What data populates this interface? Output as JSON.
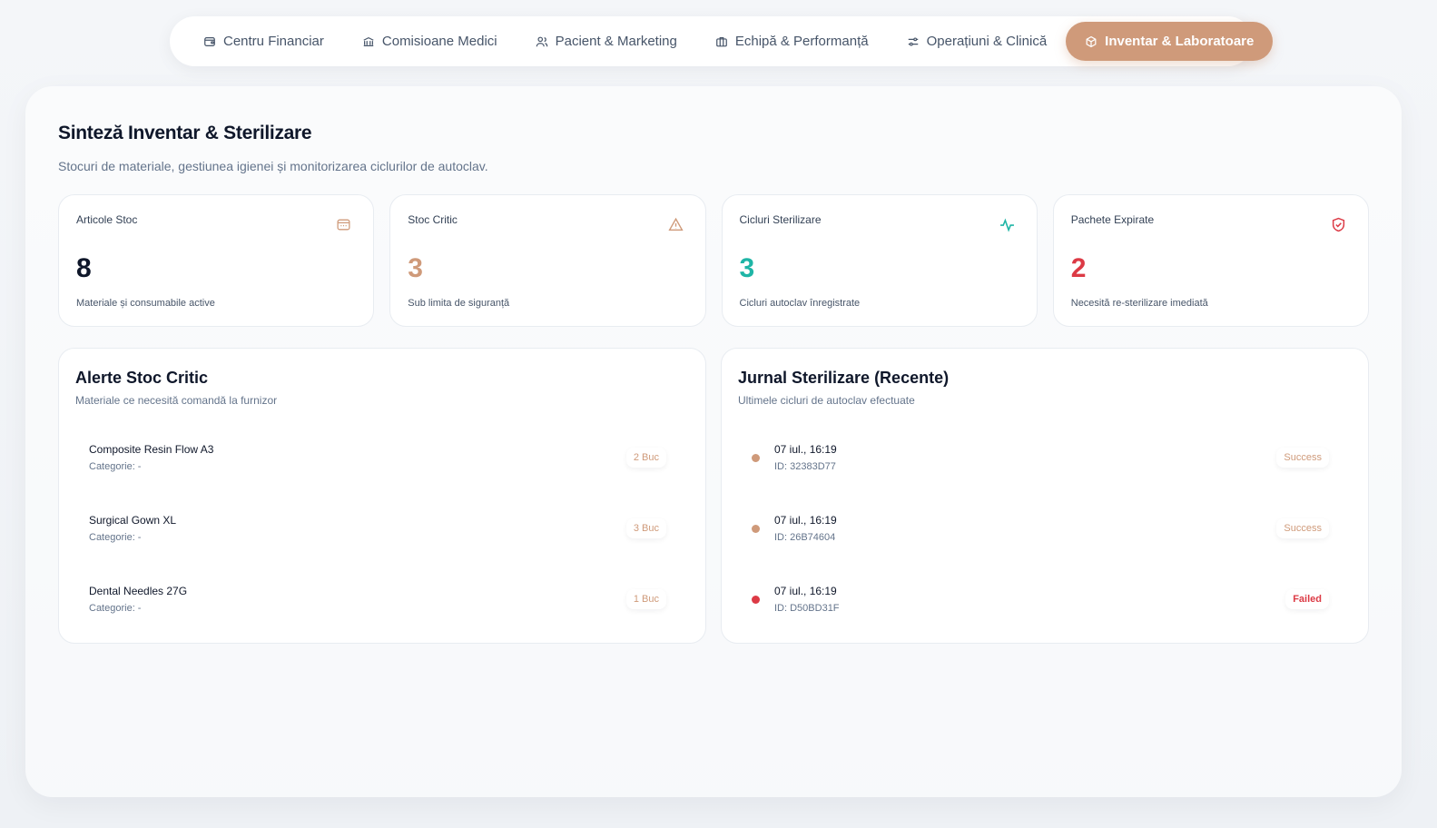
{
  "colors": {
    "accent": "#cf9a7a",
    "teal": "#1fb5a6",
    "danger": "#dc3a45",
    "dark": "#0f172a"
  },
  "nav": {
    "items": [
      {
        "label": "Centru Financiar",
        "icon": "wallet-icon"
      },
      {
        "label": "Comisioane Medici",
        "icon": "bank-icon"
      },
      {
        "label": "Pacient & Marketing",
        "icon": "users-icon"
      },
      {
        "label": "Echipă & Performanță",
        "icon": "briefcase-icon"
      },
      {
        "label": "Operațiuni & Clinică",
        "icon": "sliders-icon"
      },
      {
        "label": "Inventar & Laboratoare",
        "icon": "package-icon",
        "active": true
      }
    ]
  },
  "page": {
    "title": "Sinteză Inventar & Sterilizare",
    "subtitle": "Stocuri de materiale, gestiunea igienei și monitorizarea ciclurilor de autoclav."
  },
  "stats": [
    {
      "label": "Articole Stoc",
      "value": "8",
      "desc": "Materiale și consumabile active",
      "icon": "box-icon",
      "color": "#0f172a"
    },
    {
      "label": "Stoc Critic",
      "value": "3",
      "desc": "Sub limita de siguranță",
      "icon": "warning-icon",
      "color": "#cf9a7a"
    },
    {
      "label": "Cicluri Sterilizare",
      "value": "3",
      "desc": "Cicluri autoclav înregistrate",
      "icon": "activity-icon",
      "color": "#1fb5a6"
    },
    {
      "label": "Pachete Expirate",
      "value": "2",
      "desc": "Necesită re-sterilizare imediată",
      "icon": "shield-check-icon",
      "color": "#dc3a45"
    }
  ],
  "alerts": {
    "title": "Alerte Stoc Critic",
    "subtitle": "Materiale ce necesită comandă la furnizor",
    "items": [
      {
        "name": "Composite Resin Flow A3",
        "category": "Categorie: -",
        "qty": "2 Buc"
      },
      {
        "name": "Surgical Gown XL",
        "category": "Categorie: -",
        "qty": "3 Buc"
      },
      {
        "name": "Dental Needles 27G",
        "category": "Categorie: -",
        "qty": "1 Buc"
      }
    ]
  },
  "journal": {
    "title": "Jurnal Sterilizare (Recente)",
    "subtitle": "Ultimele cicluri de autoclav efectuate",
    "items": [
      {
        "date": "07 iul., 16:19",
        "id": "ID: 32383D77",
        "status": "Success",
        "dot": "#cf9a7a"
      },
      {
        "date": "07 iul., 16:19",
        "id": "ID: 26B74604",
        "status": "Success",
        "dot": "#cf9a7a"
      },
      {
        "date": "07 iul., 16:19",
        "id": "ID: D50BD31F",
        "status": "Failed",
        "dot": "#dc3a45"
      }
    ]
  }
}
